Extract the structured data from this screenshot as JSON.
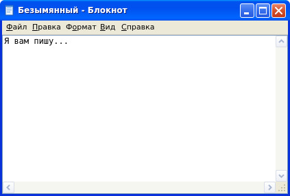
{
  "window": {
    "title": "Безымянный - Блокнот",
    "titlebar_color": "#0053ee",
    "close_color": "#d5522c"
  },
  "menu": {
    "items": [
      {
        "label_ul": "Ф",
        "label_rest": "айл"
      },
      {
        "label_ul": "П",
        "label_rest": "равка"
      },
      {
        "label_pre": "Ф",
        "label_ul": "о",
        "label_rest": "рмат"
      },
      {
        "label_ul": "В",
        "label_rest": "ид"
      },
      {
        "label_ul": "С",
        "label_rest": "правка"
      }
    ]
  },
  "editor": {
    "text": "Я вам пишу..."
  },
  "icons": {
    "app": "notepad-icon",
    "minimize": "minimize-icon",
    "maximize": "maximize-icon",
    "close": "close-icon"
  }
}
